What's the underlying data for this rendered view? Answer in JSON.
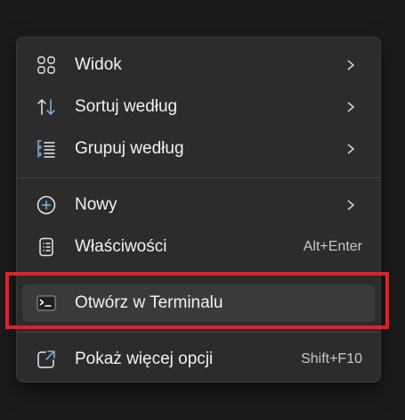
{
  "menu": {
    "items": [
      {
        "label": "Widok",
        "icon": "grid-icon",
        "has_submenu": true
      },
      {
        "label": "Sortuj według",
        "icon": "sort-icon",
        "has_submenu": true
      },
      {
        "label": "Grupuj według",
        "icon": "group-list-icon",
        "has_submenu": true
      },
      {
        "label": "Nowy",
        "icon": "plus-circle-icon",
        "has_submenu": true
      },
      {
        "label": "Właściwości",
        "icon": "properties-icon",
        "shortcut": "Alt+Enter"
      },
      {
        "label": "Otwórz w Terminalu",
        "icon": "terminal-icon",
        "highlighted": true
      },
      {
        "label": "Pokaż więcej opcji",
        "icon": "open-external-icon",
        "shortcut": "Shift+F10"
      }
    ]
  },
  "colors": {
    "menu_bg": "#2c2c2c",
    "highlight_bg": "#3a3a3a",
    "text": "#f2f2f2",
    "shortcut_text": "#c8c8c8",
    "accent_icon": "#7fb6e8",
    "annotation_red": "#e3202a"
  }
}
